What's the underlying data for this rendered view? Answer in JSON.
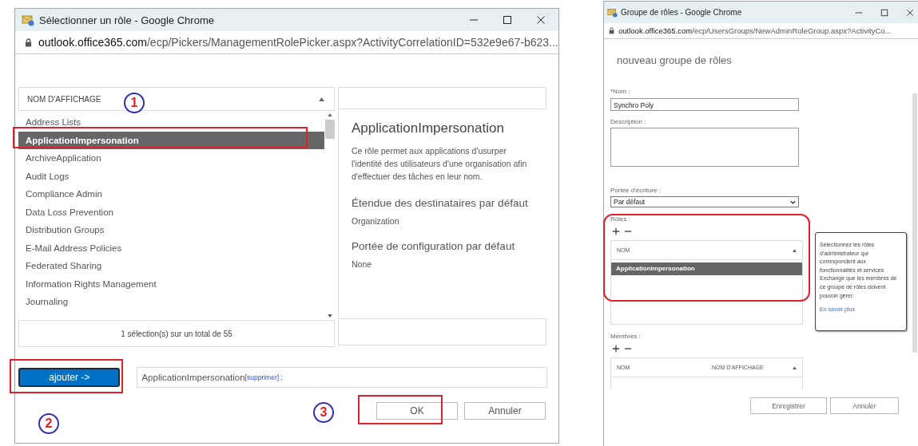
{
  "picker_window": {
    "title": "Sélectionner un rôle - Google Chrome",
    "url_host": "outlook.office365.com",
    "url_path": "/ecp/Pickers/ManagementRolePicker.aspx?ActivityCorrelationID=532e9e67-b623...",
    "list_header": "NOM D'AFFICHAGE",
    "roles": [
      {
        "name": "Address Lists",
        "selected": false
      },
      {
        "name": "ApplicationImpersonation",
        "selected": true
      },
      {
        "name": "ArchiveApplication",
        "selected": false
      },
      {
        "name": "Audit Logs",
        "selected": false
      },
      {
        "name": "Compliance Admin",
        "selected": false
      },
      {
        "name": "Data Loss Prevention",
        "selected": false
      },
      {
        "name": "Distribution Groups",
        "selected": false
      },
      {
        "name": "E-Mail Address Policies",
        "selected": false
      },
      {
        "name": "Federated Sharing",
        "selected": false
      },
      {
        "name": "Information Rights Management",
        "selected": false
      },
      {
        "name": "Journaling",
        "selected": false
      }
    ],
    "selection_count": "1 sélection(s) sur un total de 55",
    "detail": {
      "title": "ApplicationImpersonation",
      "description": "Ce rôle permet aux applications d'usurper l'identité des utilisateurs d'une organisation afin d'effectuer des tâches en leur nom.",
      "fields": [
        {
          "label": "Étendue des destinataires par défaut",
          "value": "Organization"
        },
        {
          "label": "Portée de configuration par défaut",
          "value": "None"
        }
      ]
    },
    "add_button": "ajouter ->",
    "added": [
      {
        "name": "ApplicationImpersonation",
        "remove": "[supprimer]",
        "separator": ";"
      }
    ],
    "buttons": [
      {
        "label": "OK"
      },
      {
        "label": "Annuler"
      }
    ]
  },
  "role_group_window": {
    "title": "Groupe de rôles - Google Chrome",
    "url_host": "outlook.office365.com",
    "url_path": "/ecp/UsersGroups/NewAdminRoleGroup.aspx?ActivityCo...",
    "heading": "nouveau groupe de rôles",
    "name_label": "*Nom :",
    "name_value": "Synchro Poly",
    "description_label": "Description :",
    "scope_label": "Portée d'écriture :",
    "scope_value": "Par défaut",
    "roles_label": "Rôles :",
    "roles_columns": [
      "NOM"
    ],
    "roles_rows": [
      {
        "name": "ApplicationImpersonation",
        "selected": true
      }
    ],
    "tooltip": {
      "text": "Sélectionnez les rôles d'administrateur qui correspondent aux fonctionnalités et services Exchange que les membres de ce groupe de rôles doivent pouvoir gérer.",
      "link": "En savoir plus"
    },
    "members_label": "Membres :",
    "members_columns": [
      "NOM",
      "NOM D'AFFICHAGE"
    ],
    "buttons": [
      {
        "label": "Enregistrer"
      },
      {
        "label": "Annuler"
      }
    ]
  },
  "annotations": [
    {
      "kind": "step",
      "label": "1"
    },
    {
      "kind": "step",
      "label": "2"
    },
    {
      "kind": "step",
      "label": "3"
    }
  ]
}
